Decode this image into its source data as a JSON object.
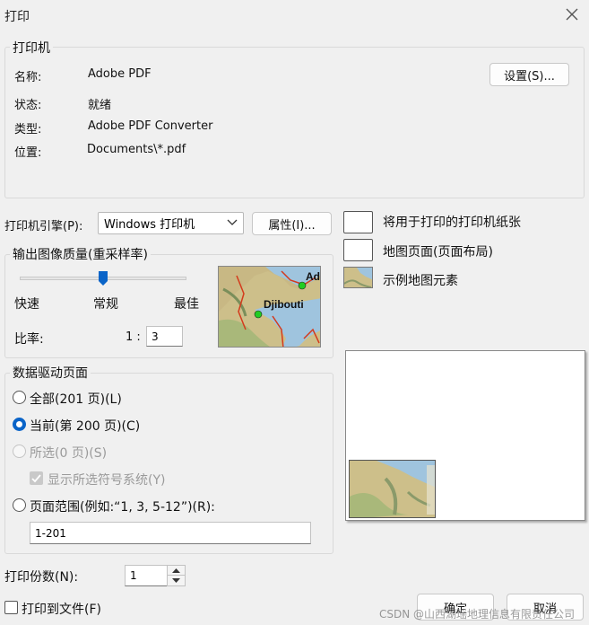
{
  "window": {
    "title": "打印"
  },
  "printer": {
    "legend": "打印机",
    "rows": [
      {
        "label": "名称:",
        "value": "Adobe PDF"
      },
      {
        "label": "状态:",
        "value": "就绪"
      },
      {
        "label": "类型:",
        "value": "Adobe PDF Converter"
      },
      {
        "label": "位置:",
        "value": "Documents\\*.pdf"
      }
    ],
    "setup_button": "设置(S)..."
  },
  "engine": {
    "label": "打印机引擎(P):",
    "selected": "Windows 打印机",
    "properties_button": "属性(I)..."
  },
  "legend_items": [
    {
      "text": "将用于打印的打印机纸张"
    },
    {
      "text": "地图页面(页面布局)"
    },
    {
      "text": "示例地图元素"
    }
  ],
  "quality": {
    "legend": "输出图像质量(重采样率)",
    "slider_level": 0.5,
    "ticks": [
      "快速",
      "常规",
      "最佳"
    ],
    "ratio_label": "比率:",
    "ratio_prefix": "1 :",
    "ratio_value": "3",
    "map_labels": {
      "city": "Djibouti",
      "partial": "Ad"
    }
  },
  "ddp": {
    "legend": "数据驱动页面",
    "options": [
      {
        "label": "全部(201 页)(L)",
        "checked": false,
        "disabled": false
      },
      {
        "label": "当前(第 200 页)(C)",
        "checked": true,
        "disabled": false
      },
      {
        "label": "所选(0 页)(S)",
        "checked": false,
        "disabled": true
      }
    ],
    "show_symbol_label": "显示所选符号系统(Y)",
    "range_label": "页面范围(例如:“1, 3, 5-12”)(R):",
    "range_value": "1-201"
  },
  "copies": {
    "label": "打印份数(N):",
    "value": "1"
  },
  "print_to_file": {
    "label": "打印到文件(F)"
  },
  "buttons": {
    "ok": "确定",
    "cancel": "取消"
  },
  "watermark": "CSDN @山西湖瑶地理信息有限责任公司",
  "colors": {
    "accent": "#0a64c8",
    "map_land": "#cdbf8a",
    "map_sea": "#9fc4de",
    "border_red": "#d43a1c",
    "point_green": "#22cc22"
  }
}
